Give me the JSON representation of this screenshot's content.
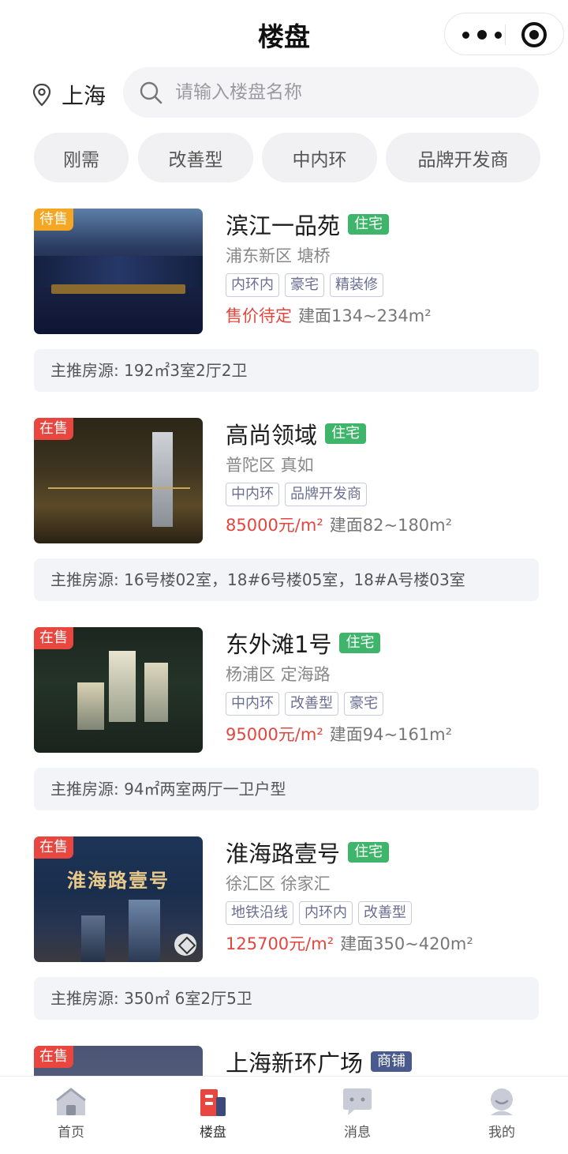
{
  "header": {
    "title": "楼盘"
  },
  "location": {
    "city": "上海"
  },
  "search": {
    "placeholder": "请输入楼盘名称",
    "value": ""
  },
  "filters": [
    "刚需",
    "改善型",
    "中内环",
    "品牌开发商"
  ],
  "listings": [
    {
      "status": "待售",
      "name": "滨江一品苑",
      "type": "住宅",
      "district": "浦东新区 塘桥",
      "tags": [
        "内环内",
        "豪宅",
        "精装修"
      ],
      "price": "售价待定",
      "area": "建面134~234m²",
      "recommend": "主推房源: 192㎡3室2厅2卫"
    },
    {
      "status": "在售",
      "name": "高尚领域",
      "type": "住宅",
      "district": "普陀区 真如",
      "tags": [
        "中内环",
        "品牌开发商"
      ],
      "price": "85000元/m²",
      "area": "建面82~180m²",
      "recommend": "主推房源: 16号楼02室，18#6号楼05室，18#A号楼03室"
    },
    {
      "status": "在售",
      "name": "东外滩1号",
      "type": "住宅",
      "district": "杨浦区 定海路",
      "tags": [
        "中内环",
        "改善型",
        "豪宅"
      ],
      "price": "95000元/m²",
      "area": "建面94~161m²",
      "recommend": "主推房源: 94㎡两室两厅一卫户型"
    },
    {
      "status": "在售",
      "name": "淮海路壹号",
      "type": "住宅",
      "district": "徐汇区 徐家汇",
      "tags": [
        "地铁沿线",
        "内环内",
        "改善型"
      ],
      "price": "125700元/m²",
      "area": "建面350~420m²",
      "recommend": "主推房源: 350㎡ 6室2厅5卫",
      "thumb_text": "淮海路壹号"
    },
    {
      "status": "在售",
      "name": "上海新环广场",
      "type": "商铺"
    }
  ],
  "tabbar": [
    {
      "label": "首页",
      "icon": "home-icon",
      "active": false
    },
    {
      "label": "楼盘",
      "icon": "building-icon",
      "active": true
    },
    {
      "label": "消息",
      "icon": "message-icon",
      "active": false
    },
    {
      "label": "我的",
      "icon": "profile-icon",
      "active": false
    }
  ],
  "colors": {
    "price": "#e2463e",
    "residential_tag": "#3fb56b",
    "commercial_tag": "#4a5a8c",
    "badge_pending": "#f5a623",
    "badge_sale": "#e8463f",
    "active_tab": "#e8463f"
  }
}
